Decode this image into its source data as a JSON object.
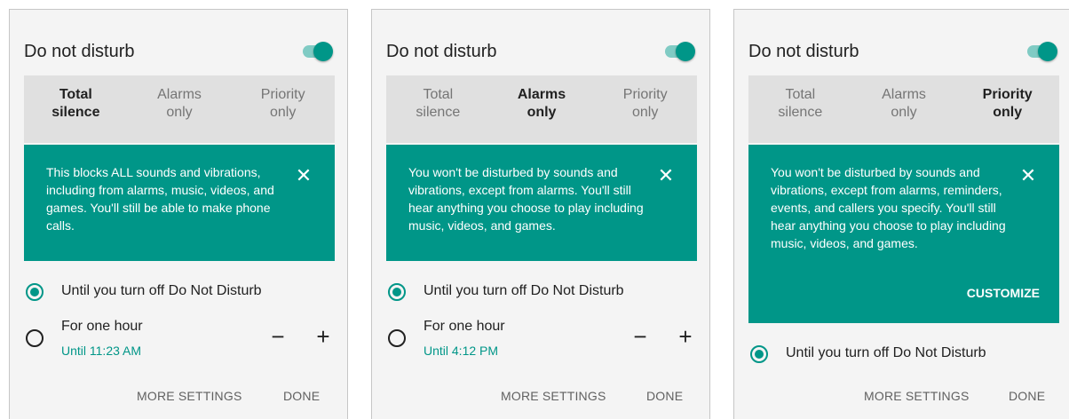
{
  "panels": [
    {
      "title": "Do not disturb",
      "modes": [
        {
          "line1": "Total",
          "line2": "silence"
        },
        {
          "line1": "Alarms",
          "line2": "only"
        },
        {
          "line1": "Priority",
          "line2": "only"
        }
      ],
      "selected_mode": "Total silence",
      "toggle_on": true,
      "info_text": "This blocks ALL sounds and vibrations, including from alarms, music, videos, and games. You'll still be able to make phone calls.",
      "options": [
        {
          "label": "Until you turn off Do Not Disturb",
          "selected": true
        },
        {
          "label": "For one hour",
          "sub": "Until 11:23 AM",
          "selected": false
        }
      ],
      "stepper": {
        "minus": "−",
        "plus": "+"
      },
      "actions": {
        "more_settings": "MORE SETTINGS",
        "done": "DONE"
      }
    },
    {
      "title": "Do not disturb",
      "modes": [
        {
          "line1": "Total",
          "line2": "silence"
        },
        {
          "line1": "Alarms",
          "line2": "only"
        },
        {
          "line1": "Priority",
          "line2": "only"
        }
      ],
      "selected_mode": "Alarms only",
      "toggle_on": true,
      "info_text": "You won't be disturbed by sounds and vibrations, except from alarms. You'll still hear anything you choose to play including music, videos, and games.",
      "options": [
        {
          "label": "Until you turn off Do Not Disturb",
          "selected": true
        },
        {
          "label": "For one hour",
          "sub": "Until 4:12 PM",
          "selected": false
        }
      ],
      "stepper": {
        "minus": "−",
        "plus": "+"
      },
      "actions": {
        "more_settings": "MORE SETTINGS",
        "done": "DONE"
      }
    },
    {
      "title": "Do not disturb",
      "modes": [
        {
          "line1": "Total",
          "line2": "silence"
        },
        {
          "line1": "Alarms",
          "line2": "only"
        },
        {
          "line1": "Priority",
          "line2": "only"
        }
      ],
      "selected_mode": "Priority only",
      "toggle_on": true,
      "info_text": "You won't be disturbed by sounds and vibrations, except from alarms, reminders, events, and callers you specify. You'll still hear anything you choose to play including music, videos, and games.",
      "customize": "CUSTOMIZE",
      "options": [
        {
          "label": "Until you turn off Do Not Disturb",
          "selected": true
        }
      ],
      "actions": {
        "more_settings": "MORE SETTINGS",
        "done": "DONE"
      }
    }
  ],
  "icons": {
    "close": "close-icon",
    "radio": "radio-button"
  },
  "colors": {
    "accent": "#009688",
    "accent_light": "#80cbc4",
    "panel_bg": "#f4f4f4",
    "mode_bar_bg": "#e0e0e0"
  }
}
